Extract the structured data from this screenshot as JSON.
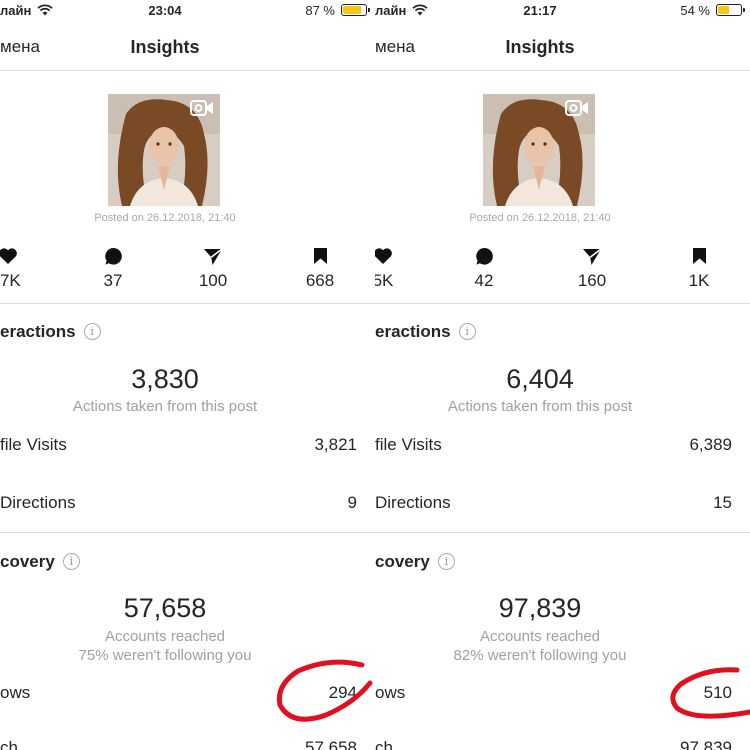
{
  "panels": [
    {
      "status": {
        "carrier": "лайн",
        "time": "23:04",
        "battery_pct": "87 %",
        "battery_level": 0.87
      },
      "nav": {
        "back": "мена",
        "title": "Insights"
      },
      "post": {
        "posted": "Posted on 26.12.2018, 21:40"
      },
      "stats": {
        "likes": ".7K",
        "comments": "37",
        "shares": "100",
        "saves": "668"
      },
      "interactions": {
        "title": "eractions",
        "total": "3,830",
        "caption": "Actions taken from this post",
        "rows": [
          {
            "label": "file Visits",
            "value": "3,821"
          },
          {
            "label": " Directions",
            "value": "9"
          }
        ]
      },
      "discovery": {
        "title": "covery",
        "total": "57,658",
        "caption1": "Accounts reached",
        "caption2": "75% weren't following you",
        "follows_label": "ows",
        "follows_value": "294",
        "reach_label": "ch",
        "reach_value": "57,658"
      }
    },
    {
      "status": {
        "carrier": "лайн",
        "time": "21:17",
        "battery_pct": "54 %",
        "battery_level": 0.54
      },
      "nav": {
        "back": "мена",
        "title": "Insights"
      },
      "post": {
        "posted": "Posted on 26.12.2018, 21:40"
      },
      "stats": {
        "likes": "5K",
        "comments": "42",
        "shares": "160",
        "saves": "1K"
      },
      "interactions": {
        "title": "eractions",
        "total": "6,404",
        "caption": "Actions taken from this post",
        "rows": [
          {
            "label": "file Visits",
            "value": "6,389"
          },
          {
            "label": " Directions",
            "value": "15"
          }
        ]
      },
      "discovery": {
        "title": "covery",
        "total": "97,839",
        "caption1": "Accounts reached",
        "caption2": "82% weren't following you",
        "follows_label": "ows",
        "follows_value": "510",
        "reach_label": "ch",
        "reach_value": "97,839"
      }
    }
  ],
  "colors": {
    "annotation": "#e0101e",
    "battery": "#f5c518",
    "muted": "#a0a0a0",
    "divider": "#dbdbdb"
  },
  "icons": [
    "wifi-icon",
    "battery-icon",
    "video-camera-icon",
    "heart-icon",
    "comment-icon",
    "send-icon",
    "bookmark-icon",
    "info-icon"
  ]
}
